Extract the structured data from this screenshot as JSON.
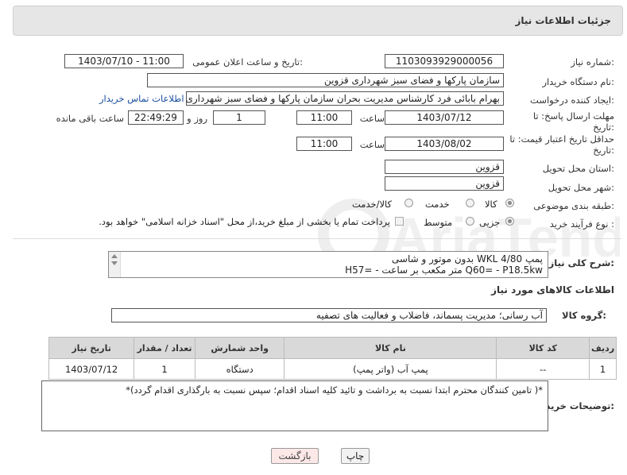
{
  "header": {
    "title": "جزئیات اطلاعات نیاز"
  },
  "fields": {
    "need_number_label": "شماره نیاز:",
    "need_number": "1103093929000056",
    "announce_label": "تاریخ و ساعت اعلان عمومی:",
    "announce_value": "1403/07/10 - 11:00",
    "buyer_org_label": "نام دستگاه خریدار:",
    "buyer_org": "سازمان پارکها و فضای سبز شهرداری قزوین",
    "creator_label": "ایجاد کننده درخواست:",
    "creator": "بهرام بابائی فرد کارشناس مدیریت بحران سازمان پارکها و فضای سبز شهرداری ق",
    "contact_link": "اطلاعات تماس خریدار",
    "deadline_label": "مهلت ارسال پاسخ: تا تاریخ:",
    "deadline_date": "1403/07/12",
    "time_label": "ساعت",
    "deadline_time": "11:00",
    "days_value": "1",
    "days_label": "روز و",
    "remaining_value": "22:49:29",
    "remaining_label": "ساعت باقی مانده",
    "validity_label": "حداقل تاریخ اعتبار قیمت: تا تاریخ:",
    "validity_date": "1403/08/02",
    "validity_time": "11:00",
    "province_label": "استان محل تحویل:",
    "province": "قزوین",
    "city_label": "شهر محل تحویل:",
    "city": "قزوین",
    "category_label": "طبقه بندی موضوعی:",
    "category_options": [
      "کالا",
      "خدمت",
      "کالا/خدمت"
    ],
    "process_label": "نوع فرآیند خرید :",
    "process_options": [
      "جزیی",
      "متوسط"
    ],
    "payment_note": "پرداخت تمام یا بخشی از مبلغ خرید،از محل \"اسناد خزانه اسلامی\" خواهد بود.",
    "desc_label": "شرح کلی نیاز:",
    "desc_line1": "پمپ  WKL 4/80 بدون موتور و شاسی",
    "desc_line2": "Q60= - P18.5kw متر مکعب بر ساعت - =H57"
  },
  "goods": {
    "section_title": "اطلاعات کالاهای مورد نیاز",
    "group_label": "گروه کالا:",
    "group_value": "آب رسانی؛ مدیریت پسماند، فاضلاب و فعالیت های تصفیه",
    "columns": [
      "ردیف",
      "کد کالا",
      "نام کالا",
      "واحد شمارش",
      "تعداد / مقدار",
      "تاریخ نیاز"
    ],
    "rows": [
      {
        "row": "1",
        "code": "--",
        "name": "پمپ آب (واتر پمپ)",
        "unit": "دستگاه",
        "qty": "1",
        "date": "1403/07/12"
      }
    ]
  },
  "notes": {
    "label": "توضیحات خریدار:",
    "text": "*( تامین کنندگان محترم ابتدا نسبت به برداشت و تائید کلیه اسناد اقدام؛ سپس نسبت به بارگذاری اقدام گردد)*"
  },
  "buttons": {
    "print": "چاپ",
    "back": "بازگشت"
  },
  "watermark": "AriaTender.neT"
}
